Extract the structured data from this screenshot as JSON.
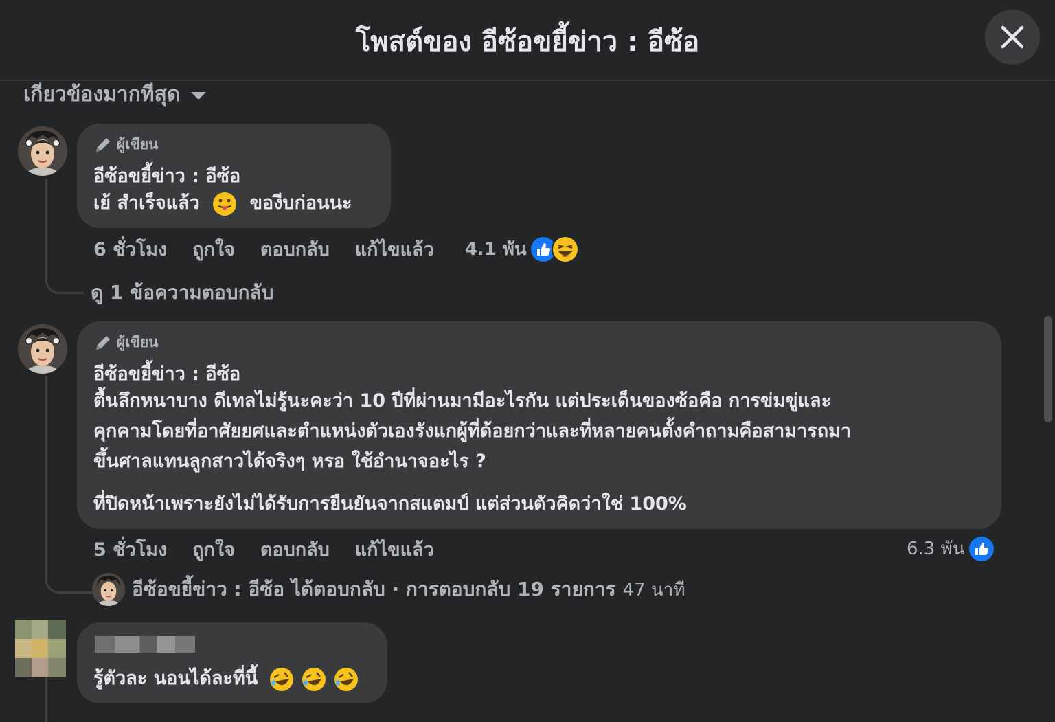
{
  "header": {
    "title": "โพสต์ของ อีซ้อขยี้ข่าว : อีซ้อ"
  },
  "sort": {
    "label": "เกี่ยวข้องมากที่สุด"
  },
  "comments": [
    {
      "badge": "ผู้เขียน",
      "author": "อีซ้อขยี้ข่าว : อีซ้อ",
      "text_before_emoji": "เย้ สำเร็จแล้ว",
      "text_after_emoji": "ของีบก่อนนะ",
      "time": "6 ชั่วโมง",
      "like": "ถูกใจ",
      "reply": "ตอบกลับ",
      "edited": "แก้ไขแล้ว",
      "reaction_count": "4.1 พัน",
      "replies_link": "ดู 1 ข้อความตอบกลับ"
    },
    {
      "badge": "ผู้เขียน",
      "author": "อีซ้อขยี้ข่าว : อีซ้อ",
      "lines": [
        "ตื้นลึกหนาบาง ดีเทลไม่รู้นะคะว่า 10 ปีที่ผ่านมามีอะไรกัน แต่ประเด็นของซ้อคือ การข่มขู่และ",
        "คุกคามโดยที่อาศัยยศและตำแหน่งตัวเองรังแกผู้ที่ด้อยกว่าและที่หลายคนตั้งคำถามคือสามารถมา",
        "ขึ้นศาลแทนลูกสาวได้จริงๆ หรอ ใช้อำนาจอะไร ?"
      ],
      "paragraph2": "ที่ปิดหน้าเพราะยังไม่ได้รับการยืนยันจากสแตมป์ แต่ส่วนตัวคิดว่าใช่ 100%",
      "time": "5 ชั่วโมง",
      "like": "ถูกใจ",
      "reply": "ตอบกลับ",
      "edited": "แก้ไขแล้ว",
      "reaction_count": "6.3 พัน",
      "reply_summary": {
        "text": "อีซ้อขยี้ข่าว : อีซ้อ ได้ตอบกลับ · การตอบกลับ 19 รายการ",
        "time": "47 นาที"
      }
    },
    {
      "text": "รู้ตัวละ นอนได้ละที่นี้"
    }
  ],
  "colors": {
    "background": "#242526",
    "bubble": "#3a3b3c",
    "text_primary": "#e4e6eb",
    "text_secondary": "#b0b3b8",
    "like_blue": "#1877f2"
  },
  "icons": [
    "close-icon",
    "caret-down-icon",
    "pencil-icon",
    "like-icon",
    "haha-icon",
    "tongue-emoji-icon",
    "rofl-emoji-icon"
  ]
}
